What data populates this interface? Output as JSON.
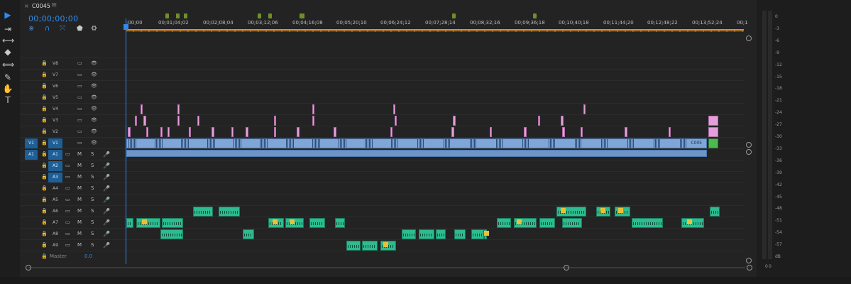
{
  "sequence": {
    "tab_close": "×",
    "name": "C0045",
    "menu_icon": "≡",
    "timecode": "00;00;00;00"
  },
  "controls": [
    {
      "name": "nest-toggle-icon",
      "glyph": "⋇"
    },
    {
      "name": "snap-magnet-icon",
      "glyph": "∩"
    },
    {
      "name": "linked-selection-icon",
      "glyph": "⤧"
    },
    {
      "name": "add-marker-icon",
      "glyph": "⬟"
    },
    {
      "name": "wrench-icon",
      "glyph": "⚙"
    }
  ],
  "tools": [
    {
      "name": "selection-tool-icon",
      "glyph": "▶",
      "selected": true
    },
    {
      "name": "track-select-tool-icon",
      "glyph": "⇥"
    },
    {
      "name": "ripple-edit-tool-icon",
      "glyph": "⟷"
    },
    {
      "name": "razor-tool-icon",
      "glyph": "◆"
    },
    {
      "name": "slip-tool-icon",
      "glyph": "⟺"
    },
    {
      "name": "pen-tool-icon",
      "glyph": "✎"
    },
    {
      "name": "hand-tool-icon",
      "glyph": "✋"
    },
    {
      "name": "type-tool-icon",
      "glyph": "T"
    }
  ],
  "ruler": {
    "labels": [
      ";00;00",
      "00;01;04;02",
      "00;02;08;04",
      "00;03;12;06",
      "00;04;16;08",
      "00;05;20;10",
      "00;06;24;12",
      "00;07;28;14",
      "00;08;32;16",
      "00;09;36;18",
      "00;10;40;18",
      "00;11;44;20",
      "00;12;48;22",
      "00;13;52;24",
      "00;1"
    ],
    "marker_color": "#6f8f2b"
  },
  "track_icons": {
    "lock": "🔒",
    "sync": "▭",
    "eye": "👁",
    "mute": "M",
    "solo": "S",
    "mic": "🎤"
  },
  "video_tracks": [
    {
      "label": "V8"
    },
    {
      "label": "V7"
    },
    {
      "label": "V6"
    },
    {
      "label": "V5"
    },
    {
      "label": "V4"
    },
    {
      "label": "V3"
    },
    {
      "label": "V2"
    },
    {
      "label": "V1",
      "source": "V1"
    }
  ],
  "audio_tracks": [
    {
      "label": "A1",
      "source": "A1"
    },
    {
      "label": "A2"
    },
    {
      "label": "A3"
    },
    {
      "label": "A4"
    },
    {
      "label": "A5"
    },
    {
      "label": "A6"
    },
    {
      "label": "A7"
    },
    {
      "label": "A8"
    },
    {
      "label": "A9"
    }
  ],
  "master": {
    "label": "Master",
    "value": "0.0"
  },
  "v1_clip_label": "C005",
  "colors": {
    "accent": "#2d8ceb",
    "video_clip": "#7ea6d8",
    "graphic_clip": "#e49fda",
    "audio_clip": "#2dbb8f"
  },
  "meter": {
    "scale": [
      "0",
      "-3",
      "-6",
      "-9",
      "-12",
      "-15",
      "-18",
      "-21",
      "-24",
      "-27",
      "-30",
      "-33",
      "-36",
      "-39",
      "-42",
      "-45",
      "-48",
      "-51",
      "-54",
      "-57",
      "dB"
    ],
    "readout_left": "0",
    "readout_right": "0"
  }
}
